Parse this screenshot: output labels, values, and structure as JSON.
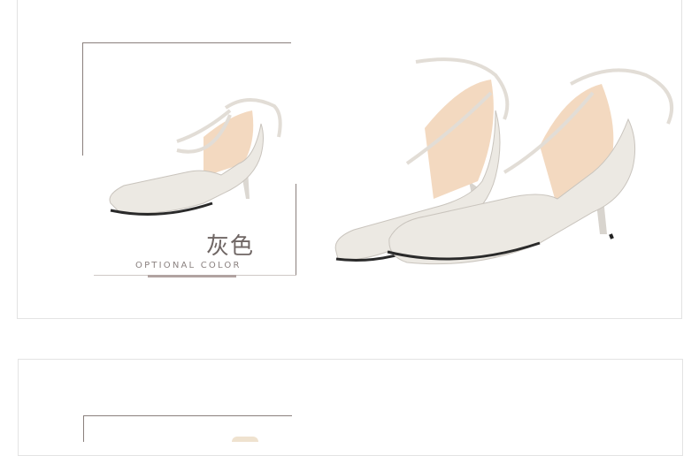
{
  "color_section": {
    "title_cn": "灰色",
    "subtitle_en": "OPTIONAL COLOR",
    "accent_color": "#b1a3a1"
  },
  "product": {
    "shoe_color": "#ece9e3",
    "lining_color": "#f3d9c0"
  }
}
